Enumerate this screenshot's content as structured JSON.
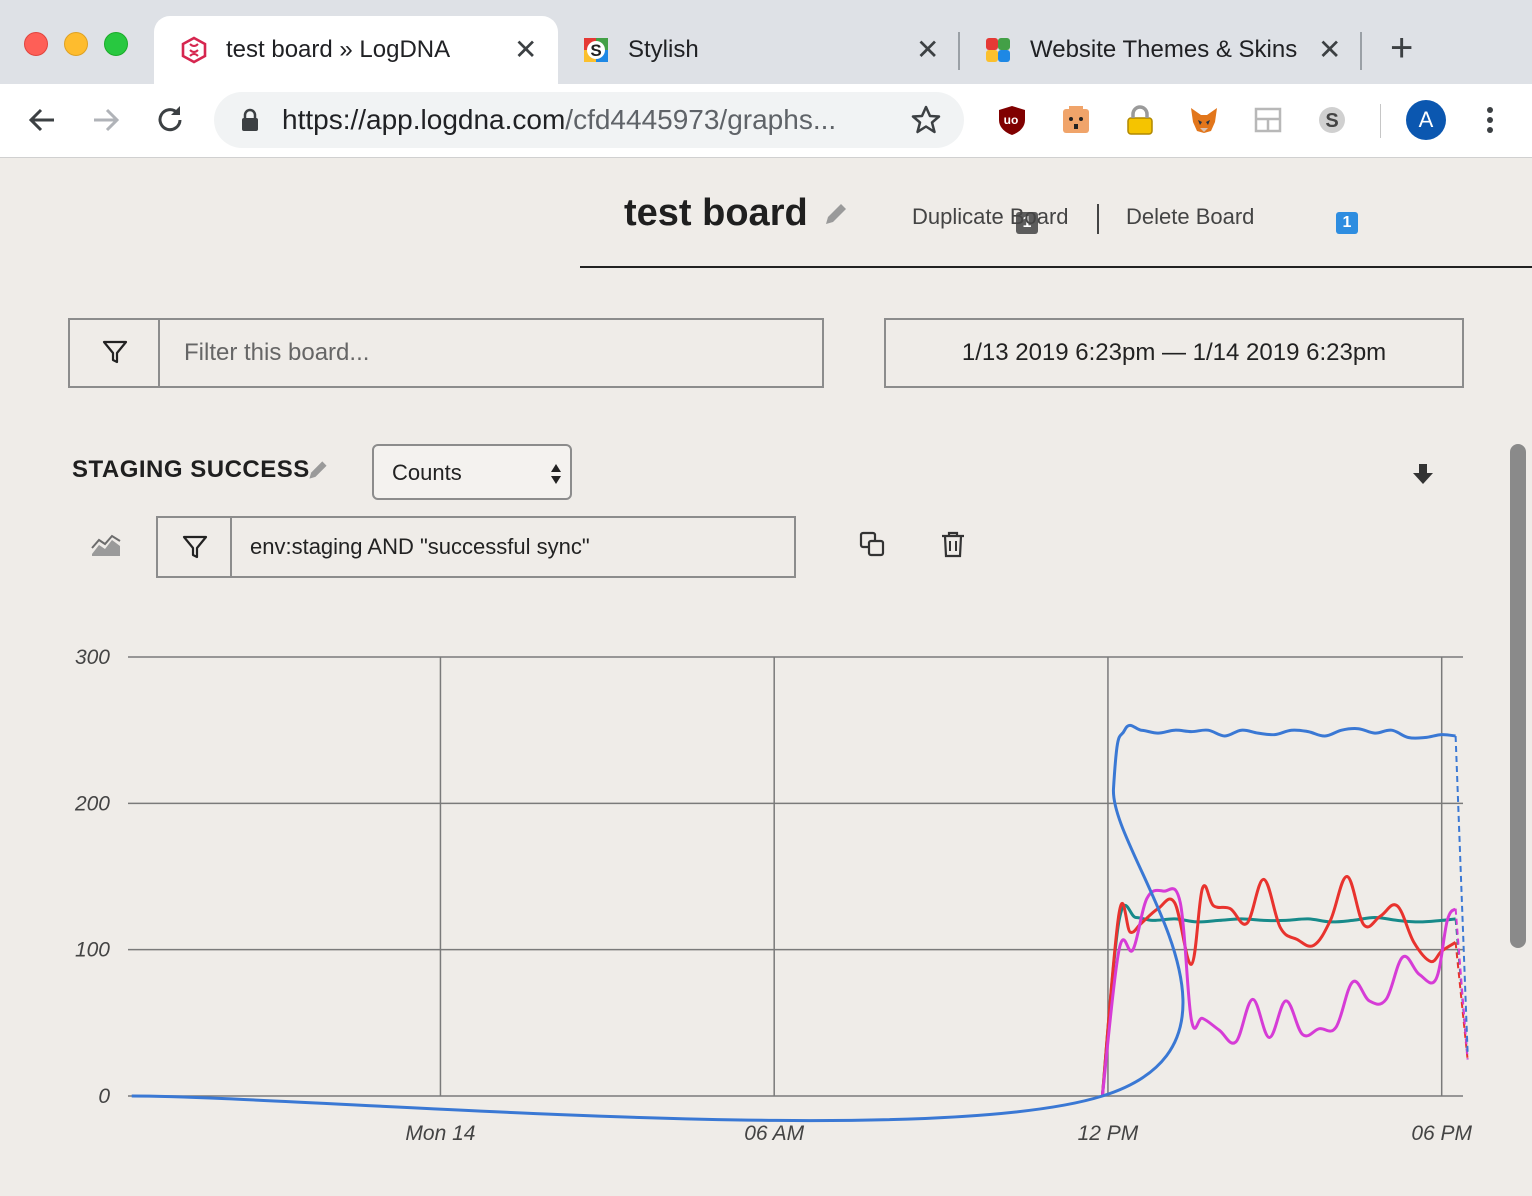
{
  "browser": {
    "tabs": [
      {
        "title": "test board » LogDNA",
        "active": true,
        "favicon": "logdna-icon"
      },
      {
        "title": "Stylish",
        "active": false,
        "favicon": "stylish-icon"
      },
      {
        "title": "Website Themes & Skins",
        "active": false,
        "favicon": "userstyles-icon"
      }
    ],
    "url_host": "https://app.logdna.com",
    "url_path": "/cfd4445973/graphs...",
    "extensions": [
      {
        "name": "ublock-icon",
        "badge": "1"
      },
      {
        "name": "honey-icon",
        "badge": ""
      },
      {
        "name": "password-lock-icon",
        "badge": ""
      },
      {
        "name": "metamask-fox-icon",
        "badge": ""
      },
      {
        "name": "layout-icon",
        "badge": ""
      },
      {
        "name": "stylish-ext-icon",
        "badge": "1"
      }
    ],
    "avatar_letter": "A",
    "accent": "#0b57b0"
  },
  "board": {
    "title": "test board",
    "duplicate_label": "Duplicate Board",
    "delete_label": "Delete Board",
    "filter_placeholder": "Filter this board...",
    "date_range": "1/13 2019 6:23pm — 1/14 2019 6:23pm"
  },
  "graph": {
    "title": "STAGING SUCCESS",
    "aggregation": "Counts",
    "query": "env:staging AND \"successful sync\""
  },
  "chart_data": {
    "type": "line",
    "title": "",
    "xlabel": "",
    "ylabel": "",
    "ylim": [
      0,
      300
    ],
    "y_ticks": [
      "300",
      "200",
      "100",
      "0"
    ],
    "x_ticks": [
      "Mon 14",
      "06 AM",
      "12 PM",
      "06 PM"
    ],
    "xlim_hours": [
      -5.617,
      18.383
    ],
    "x_tick_hours": [
      0,
      6,
      12,
      18
    ],
    "grid": true,
    "legend": "none",
    "series": [
      {
        "color": "#3a78d4",
        "x": [
          -5.55,
          11.9,
          12.1,
          12.3,
          12.6,
          12.9,
          13.2,
          13.5,
          13.8,
          14.1,
          14.4,
          14.7,
          15.0,
          15.3,
          15.6,
          15.9,
          16.2,
          16.5,
          16.8,
          17.1,
          17.4,
          17.7,
          18.0,
          18.25
        ],
        "y": [
          0,
          0,
          210,
          250,
          250,
          248,
          250,
          249,
          250,
          246,
          250,
          248,
          247,
          250,
          249,
          246,
          250,
          251,
          248,
          250,
          245,
          245,
          247,
          246
        ]
      },
      {
        "color": "#178a8a",
        "x": [
          11.9,
          12.2,
          12.5,
          12.8,
          13.2,
          13.6,
          14.0,
          14.4,
          14.8,
          15.2,
          15.6,
          16.0,
          16.4,
          16.8,
          17.2,
          17.6,
          18.0,
          18.25
        ],
        "y": [
          0,
          120,
          122,
          120,
          121,
          119,
          120,
          121,
          120,
          120,
          121,
          119,
          120,
          122,
          120,
          119,
          120,
          121
        ]
      },
      {
        "color": "#e8332e",
        "x": [
          11.9,
          12.2,
          12.4,
          12.6,
          12.9,
          13.2,
          13.5,
          13.7,
          13.9,
          14.2,
          14.5,
          14.8,
          15.1,
          15.4,
          15.7,
          16.0,
          16.3,
          16.6,
          16.9,
          17.2,
          17.5,
          17.8,
          18.0,
          18.25
        ],
        "y": [
          0,
          125,
          112,
          118,
          128,
          132,
          90,
          142,
          130,
          128,
          118,
          148,
          115,
          107,
          103,
          120,
          150,
          117,
          123,
          130,
          105,
          92,
          99,
          105
        ]
      },
      {
        "color": "#d63cd6",
        "x": [
          11.9,
          12.2,
          12.45,
          12.7,
          13.0,
          13.3,
          13.5,
          13.7,
          14.0,
          14.3,
          14.6,
          14.9,
          15.2,
          15.5,
          15.8,
          16.1,
          16.4,
          16.7,
          17.0,
          17.3,
          17.6,
          17.9,
          18.1,
          18.25
        ],
        "y": [
          0,
          100,
          100,
          135,
          140,
          132,
          52,
          53,
          45,
          37,
          66,
          40,
          65,
          42,
          46,
          47,
          78,
          65,
          66,
          95,
          83,
          80,
          120,
          128
        ]
      }
    ]
  }
}
